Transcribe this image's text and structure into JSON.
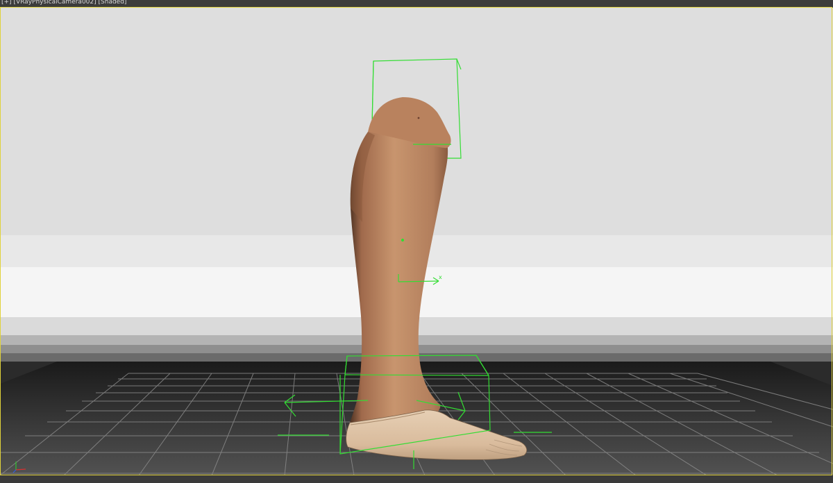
{
  "viewport": {
    "label_menu": "[+]",
    "label_camera": "[VRayPhysicalCamera002]",
    "label_shading": "[Shaded]",
    "active_border_color": "#e0d23a",
    "selection_color": "#33dd33"
  },
  "scene": {
    "object": "lower-leg prosthetic model",
    "skin_color": "#c8956e",
    "foot_color": "#e2c8ad",
    "grid": "perspective grid, dark",
    "gizmo_axis_label": "x"
  },
  "axis_tripod": {
    "x_color": "#d83030",
    "y_color": "#30c030",
    "z_color": "#3060e0"
  }
}
